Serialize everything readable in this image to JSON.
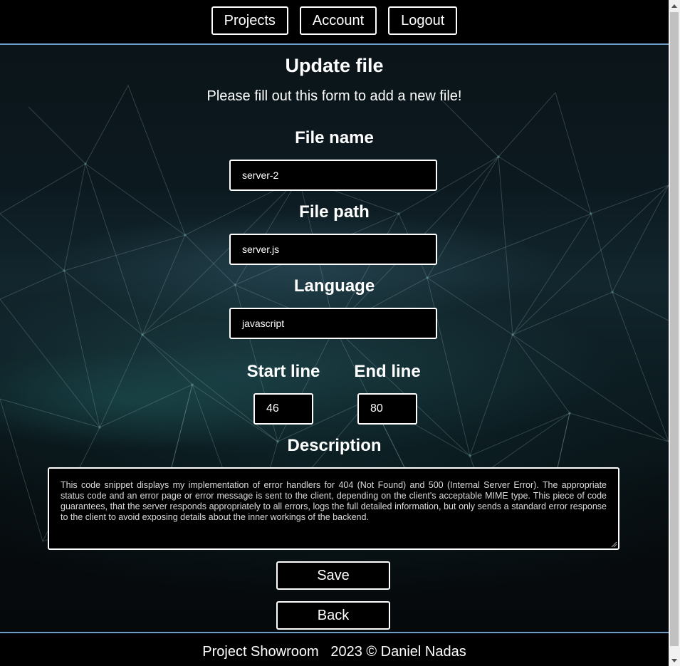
{
  "nav": {
    "projects": "Projects",
    "account": "Account",
    "logout": "Logout"
  },
  "form": {
    "title": "Update file",
    "subtitle": "Please fill out this form to add a new file!",
    "file_name_label": "File name",
    "file_name_value": "server-2",
    "file_path_label": "File path",
    "file_path_value": "server.js",
    "language_label": "Language",
    "language_value": "javascript",
    "start_line_label": "Start line",
    "start_line_value": "46",
    "end_line_label": "End line",
    "end_line_value": "80",
    "description_label": "Description",
    "description_value": "This code snippet displays my implementation of error handlers for 404 (Not Found) and 500 (Internal Server Error). The appropriate status code and an error page or error message is sent to the client, depending on the client's acceptable MIME type. This piece of code guarantees, that the server responds appropriately to all errors, logs the full detailed information, but only sends a standard error response to the client to avoid exposing details about the inner workings of the backend.",
    "save_label": "Save",
    "back_label": "Back"
  },
  "footer": {
    "text": "Project Showroom   2023 © Daniel Nadas"
  },
  "colors": {
    "header_border": "#6f9cc4",
    "field_border": "#ffffff",
    "background": "#000000"
  },
  "icons": {
    "scroll_up": "scroll-up-arrow-icon",
    "scroll_down": "scroll-down-arrow-icon",
    "resize": "resize-grip-icon"
  }
}
